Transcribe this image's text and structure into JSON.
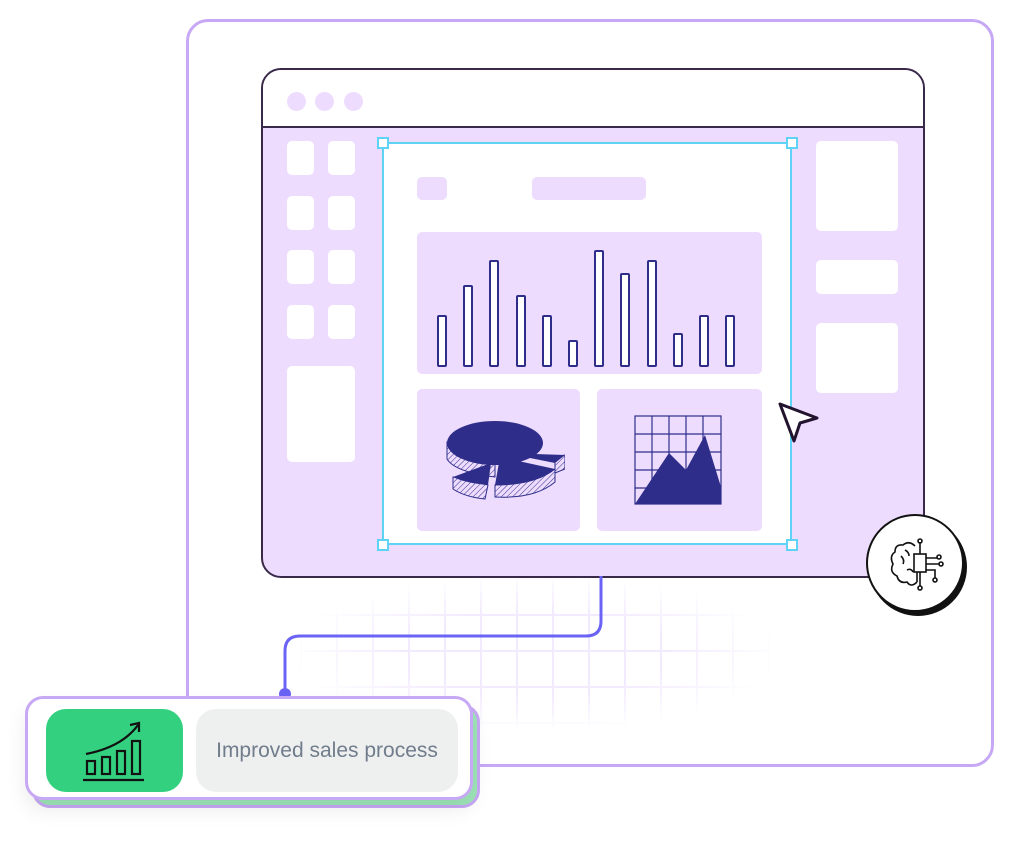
{
  "card": {
    "label": "Improved sales process",
    "icon": "growth-chart-icon"
  },
  "canvas": {
    "bar_chart": {
      "type": "bar",
      "values": [
        52,
        82,
        107,
        72,
        52,
        27,
        117,
        94,
        107,
        34,
        52,
        52
      ]
    },
    "pie_icon": "pie-chart-icon",
    "area_icon": "area-chart-icon"
  },
  "ai_badge": {
    "icon": "brain-circuit-icon"
  },
  "cursor": {
    "icon": "cursor-arrow-icon"
  },
  "colors": {
    "accent": "#c7a8f5",
    "window": "#eedcff",
    "selection": "#5fd3f5",
    "chart": "#2e2e8a",
    "connector": "#6b63f5",
    "success": "#33d17f"
  }
}
